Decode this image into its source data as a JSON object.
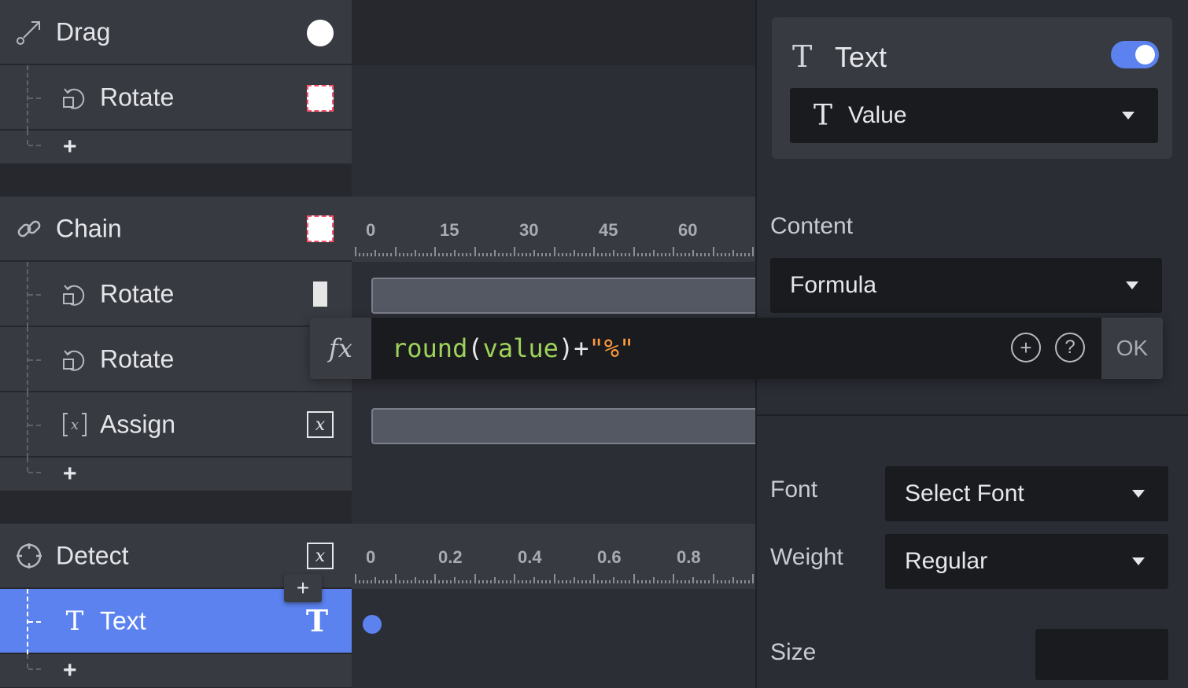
{
  "layers": {
    "drag": {
      "label": "Drag",
      "icon": "drag-handle-icon"
    },
    "drag_rotate": {
      "label": "Rotate",
      "icon": "rotate-icon"
    },
    "chain": {
      "label": "Chain",
      "icon": "link-icon"
    },
    "chain_rotate_1": {
      "label": "Rotate",
      "icon": "rotate-icon"
    },
    "chain_rotate_2": {
      "label": "Rotate",
      "icon": "rotate-icon"
    },
    "assign": {
      "label": "Assign",
      "icon": "variable-icon"
    },
    "detect": {
      "label": "Detect",
      "icon": "crosshair-icon"
    },
    "text": {
      "label": "Text",
      "icon": "text-icon"
    },
    "add_symbol": "+"
  },
  "ruler_chain": {
    "labels": [
      "0",
      "15",
      "30",
      "45",
      "60"
    ]
  },
  "ruler_detect": {
    "labels": [
      "0",
      "0.2",
      "0.4",
      "0.6",
      "0.8"
    ]
  },
  "formula": {
    "fx_label": "fx",
    "fn": "round",
    "arg": "value",
    "op": "+",
    "str": "\"%\"",
    "ok_label": "OK"
  },
  "panel": {
    "title": "Text",
    "title_icon": "T",
    "enabled": true,
    "value_dropdown": "Value",
    "content_label": "Content",
    "content_dropdown": "Formula",
    "font_label": "Font",
    "font_dropdown": "Select Font",
    "weight_label": "Weight",
    "weight_dropdown": "Regular",
    "size_label": "Size"
  },
  "colors": {
    "accent": "#5b82ef",
    "code_function": "#9fd35a",
    "code_string": "#ff9a3c"
  }
}
